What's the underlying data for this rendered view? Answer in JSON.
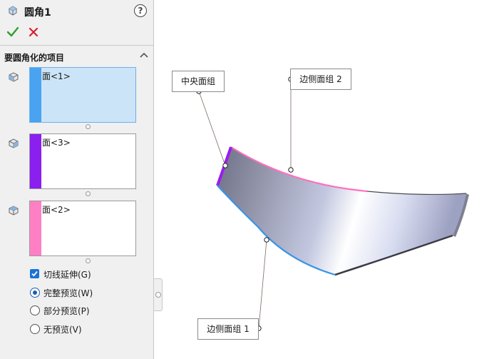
{
  "panel": {
    "title": "圆角1",
    "help_label": "?",
    "section_title": "要圆角化的项目",
    "faces": [
      {
        "label": "面<1>",
        "color": "#4aa3f0"
      },
      {
        "label": "面<3>",
        "color": "#8a1ff0"
      },
      {
        "label": "面<2>",
        "color": "#ff7fc4"
      }
    ],
    "options": {
      "tangent": "切线延伸(G)",
      "full_preview": "完整预览(W)",
      "partial_preview": "部分预览(P)",
      "no_preview": "无预览(V)"
    }
  },
  "callouts": {
    "center": "中央面组",
    "side2": "边侧面组 2",
    "side1": "边侧面组 1"
  },
  "colors": {
    "accent_ok": "#2e9e2e",
    "cancel": "#d9202a",
    "selection": "#cce4f7"
  }
}
